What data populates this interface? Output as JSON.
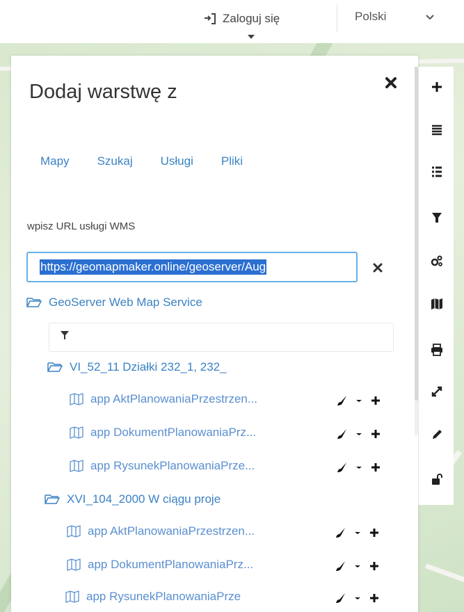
{
  "topbar": {
    "login_label": "Zaloguj się",
    "language_label": "Polski"
  },
  "panel": {
    "title": "Dodaj warstwę z",
    "tabs": [
      {
        "label": "Mapy"
      },
      {
        "label": "Szukaj"
      },
      {
        "label": "Usługi"
      },
      {
        "label": "Pliki"
      }
    ],
    "url_label": "wpisz URL usługi WMS",
    "url_value": "https://geomapmaker.online/geoserver/Aug"
  },
  "tree": {
    "service_name": "GeoServer Web Map Service",
    "groups": [
      {
        "name": "VI_52_11 Działki 232_1, 232_",
        "layers": [
          {
            "name": "app AktPlanowaniaPrzestrzen..."
          },
          {
            "name": "app DokumentPlanowaniaPrz..."
          },
          {
            "name": "app RysunekPlanowaniaPrze..."
          }
        ]
      },
      {
        "name": "XVI_104_2000 W ciągu proje",
        "layers": [
          {
            "name": "app AktPlanowaniaPrzestrzen..."
          },
          {
            "name": "app DokumentPlanowaniaPrz..."
          },
          {
            "name": "app RysunekPlanowaniaPrze"
          }
        ]
      }
    ]
  },
  "icons": {
    "login": "sign-in-icon",
    "close": "close-icon",
    "folder": "folder-open-icon",
    "layer": "map-icon",
    "filter": "filter-icon",
    "edit": "brush-icon",
    "more": "caret-down-icon",
    "add": "plus-icon"
  },
  "colors": {
    "link": "#3b82c4",
    "input_border": "#66afe9",
    "selection": "#2b6fd1"
  }
}
